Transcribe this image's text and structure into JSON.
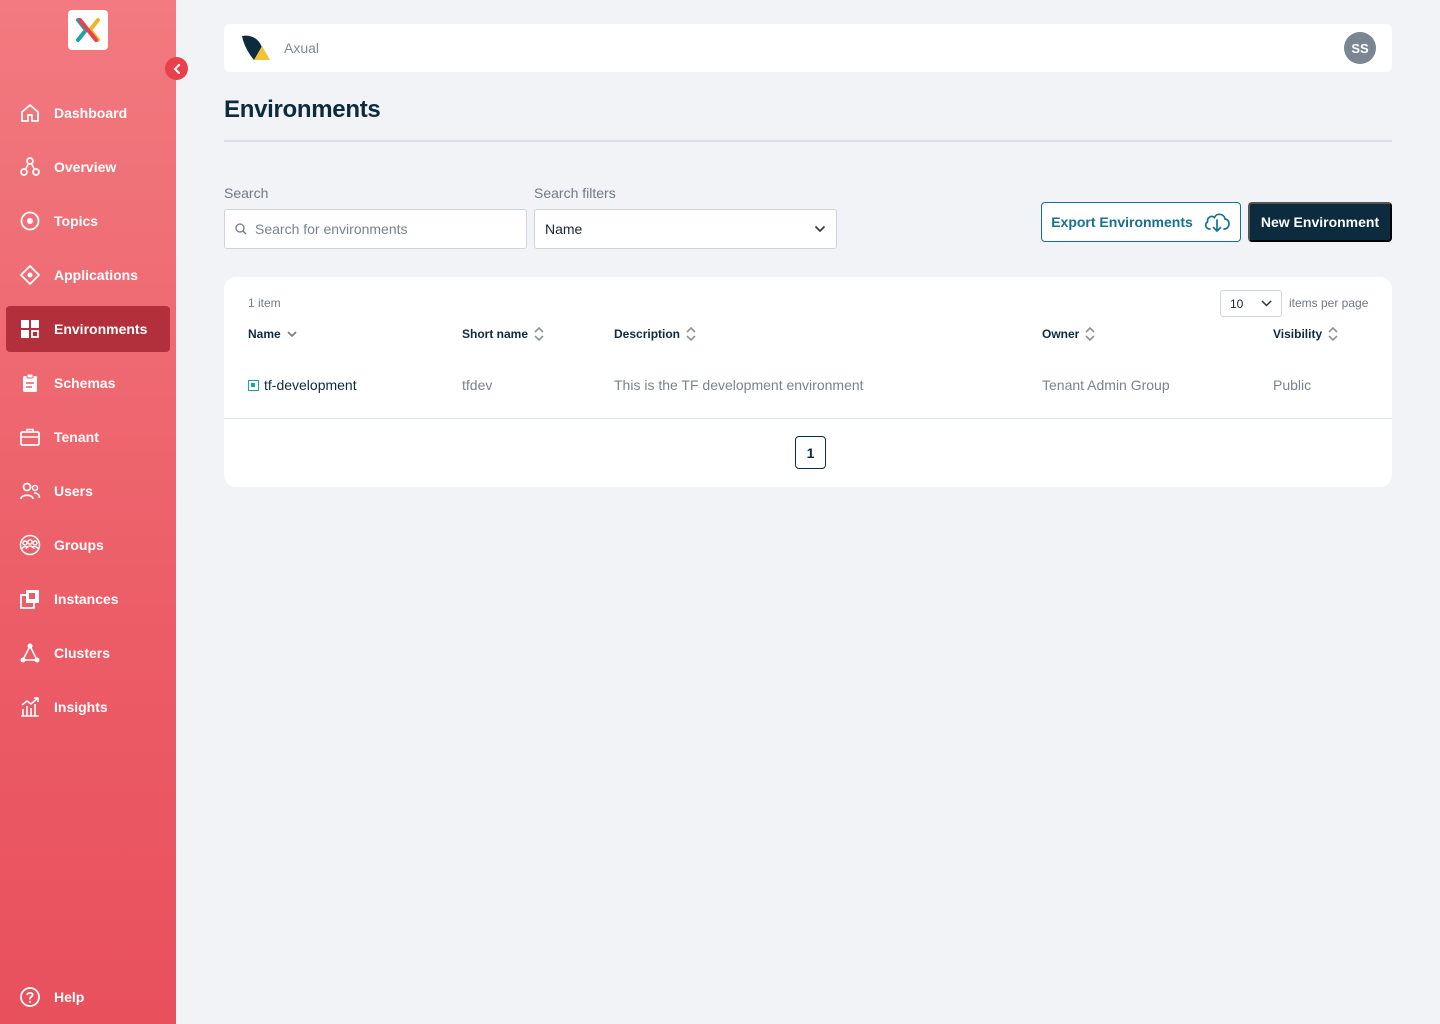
{
  "brand": {
    "name": "Axual",
    "avatar_initials": "SS"
  },
  "sidebar": {
    "items": [
      {
        "label": "Dashboard",
        "icon": "home-icon",
        "active": false
      },
      {
        "label": "Overview",
        "icon": "overview-icon",
        "active": false
      },
      {
        "label": "Topics",
        "icon": "topics-icon",
        "active": false
      },
      {
        "label": "Applications",
        "icon": "applications-icon",
        "active": false
      },
      {
        "label": "Environments",
        "icon": "environments-icon",
        "active": true
      },
      {
        "label": "Schemas",
        "icon": "schemas-icon",
        "active": false
      },
      {
        "label": "Tenant",
        "icon": "tenant-icon",
        "active": false
      },
      {
        "label": "Users",
        "icon": "users-icon",
        "active": false
      },
      {
        "label": "Groups",
        "icon": "groups-icon",
        "active": false
      },
      {
        "label": "Instances",
        "icon": "instances-icon",
        "active": false
      },
      {
        "label": "Clusters",
        "icon": "clusters-icon",
        "active": false
      },
      {
        "label": "Insights",
        "icon": "insights-icon",
        "active": false
      }
    ],
    "help_label": "Help"
  },
  "page": {
    "title": "Environments"
  },
  "filters": {
    "search_label": "Search",
    "search_placeholder": "Search for environments",
    "search_value": "",
    "filter_label": "Search filters",
    "filter_value": "Name"
  },
  "actions": {
    "export_label": "Export Environments",
    "new_label": "New Environment"
  },
  "table": {
    "count": "1 item",
    "per_page_value": "10",
    "per_page_label": "items per page",
    "columns": {
      "name": "Name",
      "short_name": "Short name",
      "description": "Description",
      "owner": "Owner",
      "visibility": "Visibility"
    },
    "rows": [
      {
        "name": "tf-development",
        "short_name": "tfdev",
        "description": "This is the TF development environment",
        "owner": "Tenant Admin Group",
        "visibility": "Public"
      }
    ],
    "current_page": "1"
  },
  "colors": {
    "sidebar_top": "#f27a80",
    "sidebar_bottom": "#e8505c",
    "sidebar_active": "#b22f3c",
    "primary_dark": "#0d2b3e",
    "accent_teal": "#18708f",
    "env_icon": "#1ba3a8"
  }
}
